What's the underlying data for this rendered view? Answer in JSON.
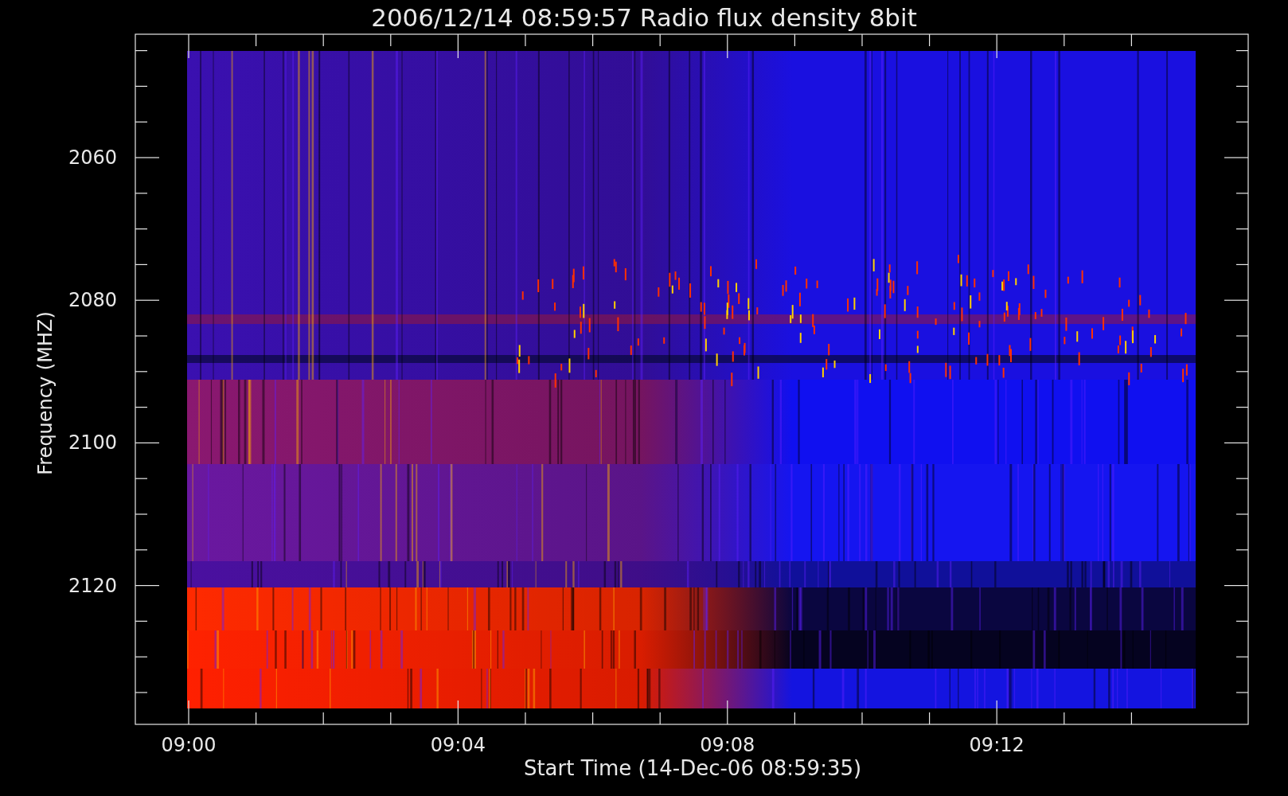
{
  "title": "2006/12/14 08:59:57 Radio flux density 8bit",
  "y_axis": {
    "label": "Frequency (MHZ)",
    "ticks": [
      "2060",
      "2080",
      "2100",
      "2120"
    ]
  },
  "x_axis": {
    "label": "Start Time (14-Dec-06 08:59:35)",
    "ticks": [
      "09:00",
      "09:04",
      "09:08",
      "09:12"
    ]
  }
}
